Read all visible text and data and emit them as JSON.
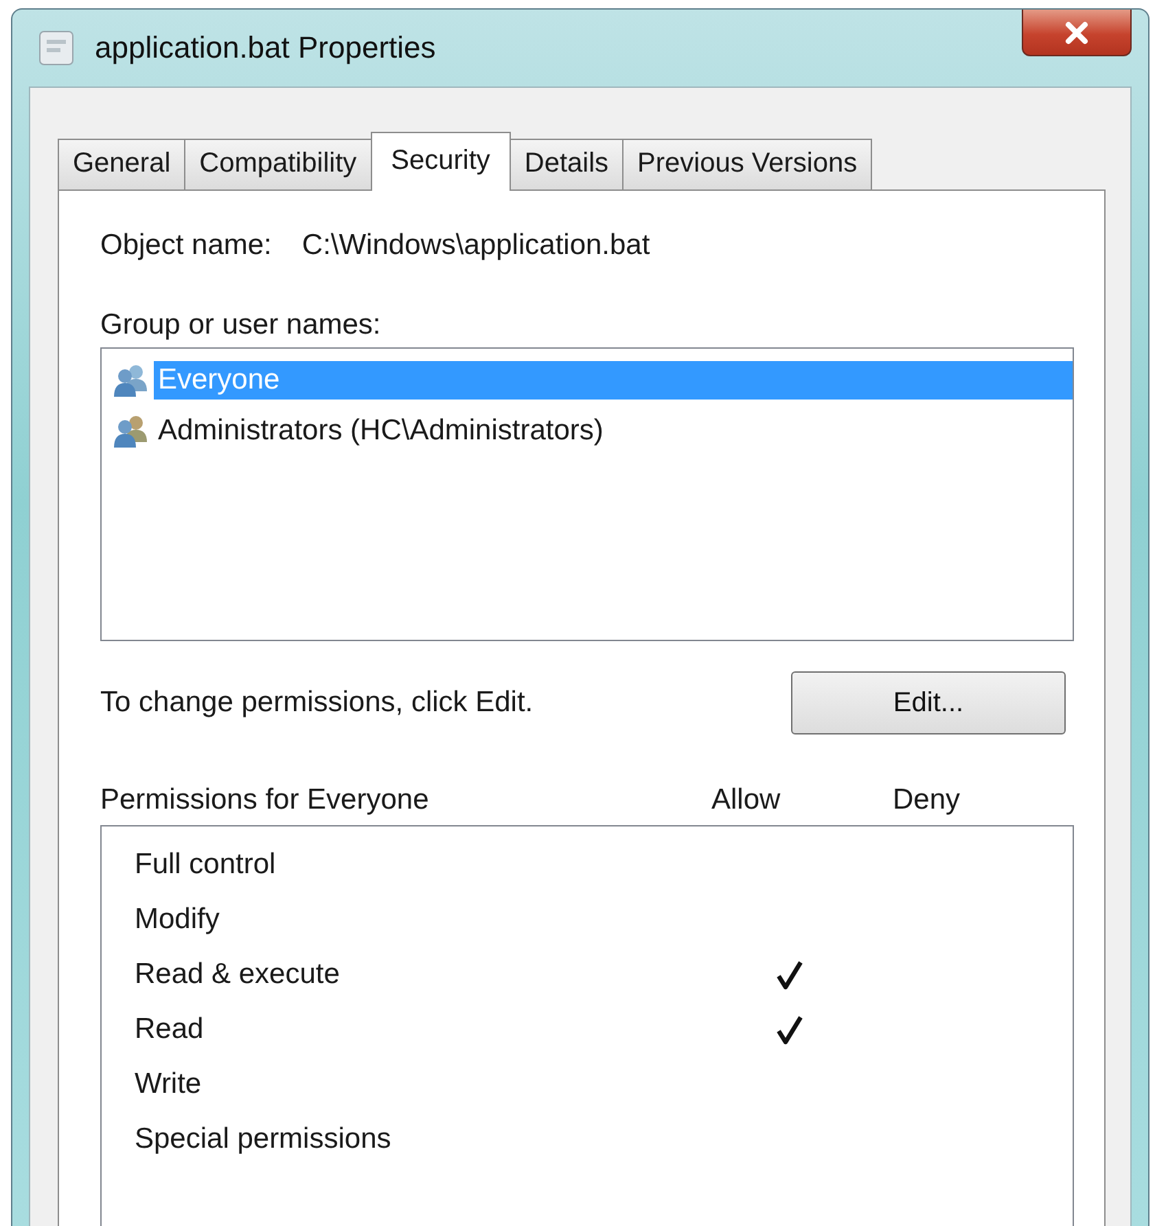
{
  "window": {
    "title": "application.bat Properties"
  },
  "tabs": [
    {
      "label": "General",
      "selected": false
    },
    {
      "label": "Compatibility",
      "selected": false
    },
    {
      "label": "Security",
      "selected": true
    },
    {
      "label": "Details",
      "selected": false
    },
    {
      "label": "Previous Versions",
      "selected": false
    }
  ],
  "object_name": {
    "label": "Object name:",
    "value": "C:\\Windows\\application.bat"
  },
  "groups": {
    "label": "Group or user names:",
    "items": [
      {
        "name": "Everyone",
        "selected": true
      },
      {
        "name": "Administrators (HC\\Administrators)",
        "selected": false
      }
    ]
  },
  "change_hint": "To change permissions, click Edit.",
  "edit_button": "Edit...",
  "permissions": {
    "label": "Permissions for Everyone",
    "columns": [
      "Allow",
      "Deny"
    ],
    "rows": [
      {
        "name": "Full control",
        "allow": false,
        "deny": false
      },
      {
        "name": "Modify",
        "allow": false,
        "deny": false
      },
      {
        "name": "Read & execute",
        "allow": true,
        "deny": false
      },
      {
        "name": "Read",
        "allow": true,
        "deny": false
      },
      {
        "name": "Write",
        "allow": false,
        "deny": false
      },
      {
        "name": "Special permissions",
        "allow": false,
        "deny": false
      }
    ]
  }
}
